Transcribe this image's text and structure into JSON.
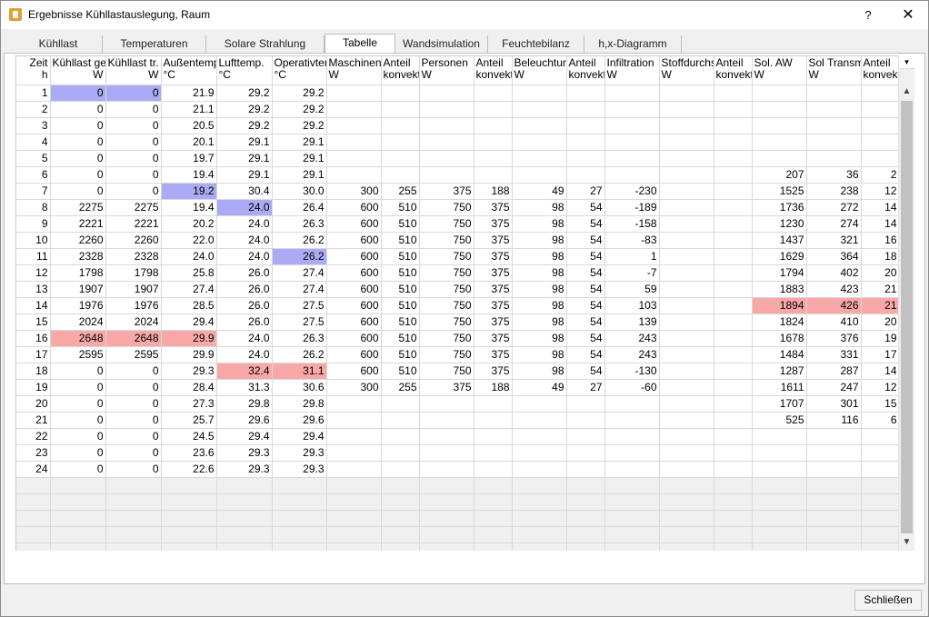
{
  "window": {
    "title": "Ergebnisse Kühllastauslegung, Raum",
    "help": "?",
    "close": "✕"
  },
  "tabs": [
    {
      "label": "Kühllast"
    },
    {
      "label": "Temperaturen"
    },
    {
      "label": "Solare Strahlung"
    },
    {
      "label": "Tabelle"
    },
    {
      "label": "Wandsimulation"
    },
    {
      "label": "Feuchtebilanz"
    },
    {
      "label": "h,x-Diagramm"
    }
  ],
  "active_tab": "Tabelle",
  "table": {
    "columns": [
      {
        "name": "Zeit",
        "unit": "h"
      },
      {
        "name": "Kühllast ges.",
        "unit": "W"
      },
      {
        "name": "Kühllast tr.",
        "unit": "W"
      },
      {
        "name": "Außentemp.",
        "unit": "°C"
      },
      {
        "name": "Lufttemp.",
        "unit": "°C"
      },
      {
        "name": "Operativtem",
        "unit": "°C"
      },
      {
        "name": "Maschinen",
        "unit": "W"
      },
      {
        "name": "Anteil",
        "unit": "konvekt"
      },
      {
        "name": "Personen",
        "unit": "W"
      },
      {
        "name": "Anteil",
        "unit": "konvekt"
      },
      {
        "name": "Beleuchtung",
        "unit": "W"
      },
      {
        "name": "Anteil",
        "unit": "konvekt"
      },
      {
        "name": "Infiltration",
        "unit": "W"
      },
      {
        "name": "Stoffdurchsa",
        "unit": "W"
      },
      {
        "name": "Anteil",
        "unit": "konvekt"
      },
      {
        "name": "Sol. AW",
        "unit": "W"
      },
      {
        "name": "Sol Transm.",
        "unit": "W"
      },
      {
        "name": "Anteil",
        "unit": "konvekt"
      }
    ],
    "rows": [
      [
        "1",
        "0",
        "0",
        "21.9",
        "29.2",
        "29.2",
        "",
        "",
        "",
        "",
        "",
        "",
        "",
        "",
        "",
        "",
        "",
        ""
      ],
      [
        "2",
        "0",
        "0",
        "21.1",
        "29.2",
        "29.2",
        "",
        "",
        "",
        "",
        "",
        "",
        "",
        "",
        "",
        "",
        "",
        ""
      ],
      [
        "3",
        "0",
        "0",
        "20.5",
        "29.2",
        "29.2",
        "",
        "",
        "",
        "",
        "",
        "",
        "",
        "",
        "",
        "",
        "",
        ""
      ],
      [
        "4",
        "0",
        "0",
        "20.1",
        "29.1",
        "29.1",
        "",
        "",
        "",
        "",
        "",
        "",
        "",
        "",
        "",
        "",
        "",
        ""
      ],
      [
        "5",
        "0",
        "0",
        "19.7",
        "29.1",
        "29.1",
        "",
        "",
        "",
        "",
        "",
        "",
        "",
        "",
        "",
        "",
        "",
        ""
      ],
      [
        "6",
        "0",
        "0",
        "19.4",
        "29.1",
        "29.1",
        "",
        "",
        "",
        "",
        "",
        "",
        "",
        "",
        "",
        "207",
        "36",
        "2"
      ],
      [
        "7",
        "0",
        "0",
        "19.2",
        "30.4",
        "30.0",
        "300",
        "255",
        "375",
        "188",
        "49",
        "27",
        "-230",
        "",
        "",
        "1525",
        "238",
        "12"
      ],
      [
        "8",
        "2275",
        "2275",
        "19.4",
        "24.0",
        "26.4",
        "600",
        "510",
        "750",
        "375",
        "98",
        "54",
        "-189",
        "",
        "",
        "1736",
        "272",
        "14"
      ],
      [
        "9",
        "2221",
        "2221",
        "20.2",
        "24.0",
        "26.3",
        "600",
        "510",
        "750",
        "375",
        "98",
        "54",
        "-158",
        "",
        "",
        "1230",
        "274",
        "14"
      ],
      [
        "10",
        "2260",
        "2260",
        "22.0",
        "24.0",
        "26.2",
        "600",
        "510",
        "750",
        "375",
        "98",
        "54",
        "-83",
        "",
        "",
        "1437",
        "321",
        "16"
      ],
      [
        "11",
        "2328",
        "2328",
        "24.0",
        "24.0",
        "26.2",
        "600",
        "510",
        "750",
        "375",
        "98",
        "54",
        "1",
        "",
        "",
        "1629",
        "364",
        "18"
      ],
      [
        "12",
        "1798",
        "1798",
        "25.8",
        "26.0",
        "27.4",
        "600",
        "510",
        "750",
        "375",
        "98",
        "54",
        "-7",
        "",
        "",
        "1794",
        "402",
        "20"
      ],
      [
        "13",
        "1907",
        "1907",
        "27.4",
        "26.0",
        "27.4",
        "600",
        "510",
        "750",
        "375",
        "98",
        "54",
        "59",
        "",
        "",
        "1883",
        "423",
        "21"
      ],
      [
        "14",
        "1976",
        "1976",
        "28.5",
        "26.0",
        "27.5",
        "600",
        "510",
        "750",
        "375",
        "98",
        "54",
        "103",
        "",
        "",
        "1894",
        "426",
        "21"
      ],
      [
        "15",
        "2024",
        "2024",
        "29.4",
        "26.0",
        "27.5",
        "600",
        "510",
        "750",
        "375",
        "98",
        "54",
        "139",
        "",
        "",
        "1824",
        "410",
        "20"
      ],
      [
        "16",
        "2648",
        "2648",
        "29.9",
        "24.0",
        "26.3",
        "600",
        "510",
        "750",
        "375",
        "98",
        "54",
        "243",
        "",
        "",
        "1678",
        "376",
        "19"
      ],
      [
        "17",
        "2595",
        "2595",
        "29.9",
        "24.0",
        "26.2",
        "600",
        "510",
        "750",
        "375",
        "98",
        "54",
        "243",
        "",
        "",
        "1484",
        "331",
        "17"
      ],
      [
        "18",
        "0",
        "0",
        "29.3",
        "32.4",
        "31.1",
        "600",
        "510",
        "750",
        "375",
        "98",
        "54",
        "-130",
        "",
        "",
        "1287",
        "287",
        "14"
      ],
      [
        "19",
        "0",
        "0",
        "28.4",
        "31.3",
        "30.6",
        "300",
        "255",
        "375",
        "188",
        "49",
        "27",
        "-60",
        "",
        "",
        "1611",
        "247",
        "12"
      ],
      [
        "20",
        "0",
        "0",
        "27.3",
        "29.8",
        "29.8",
        "",
        "",
        "",
        "",
        "",
        "",
        "",
        "",
        "",
        "1707",
        "301",
        "15"
      ],
      [
        "21",
        "0",
        "0",
        "25.7",
        "29.6",
        "29.6",
        "",
        "",
        "",
        "",
        "",
        "",
        "",
        "",
        "",
        "525",
        "116",
        "6"
      ],
      [
        "22",
        "0",
        "0",
        "24.5",
        "29.4",
        "29.4",
        "",
        "",
        "",
        "",
        "",
        "",
        "",
        "",
        "",
        "",
        "",
        ""
      ],
      [
        "23",
        "0",
        "0",
        "23.6",
        "29.3",
        "29.3",
        "",
        "",
        "",
        "",
        "",
        "",
        "",
        "",
        "",
        "",
        "",
        ""
      ],
      [
        "24",
        "0",
        "0",
        "22.6",
        "29.3",
        "29.3",
        "",
        "",
        "",
        "",
        "",
        "",
        "",
        "",
        "",
        "",
        "",
        ""
      ]
    ],
    "highlights_min": [
      [
        0,
        1
      ],
      [
        0,
        2
      ],
      [
        6,
        3
      ],
      [
        7,
        4
      ],
      [
        10,
        5
      ]
    ],
    "highlights_max": [
      [
        15,
        1
      ],
      [
        15,
        2
      ],
      [
        15,
        3
      ],
      [
        17,
        4
      ],
      [
        17,
        5
      ],
      [
        13,
        15
      ],
      [
        13,
        16
      ],
      [
        13,
        17
      ]
    ],
    "colors": {
      "min": "#aaaaf5",
      "max": "#f9a8a8"
    }
  },
  "buttons": {
    "close_label": "Schließen"
  }
}
